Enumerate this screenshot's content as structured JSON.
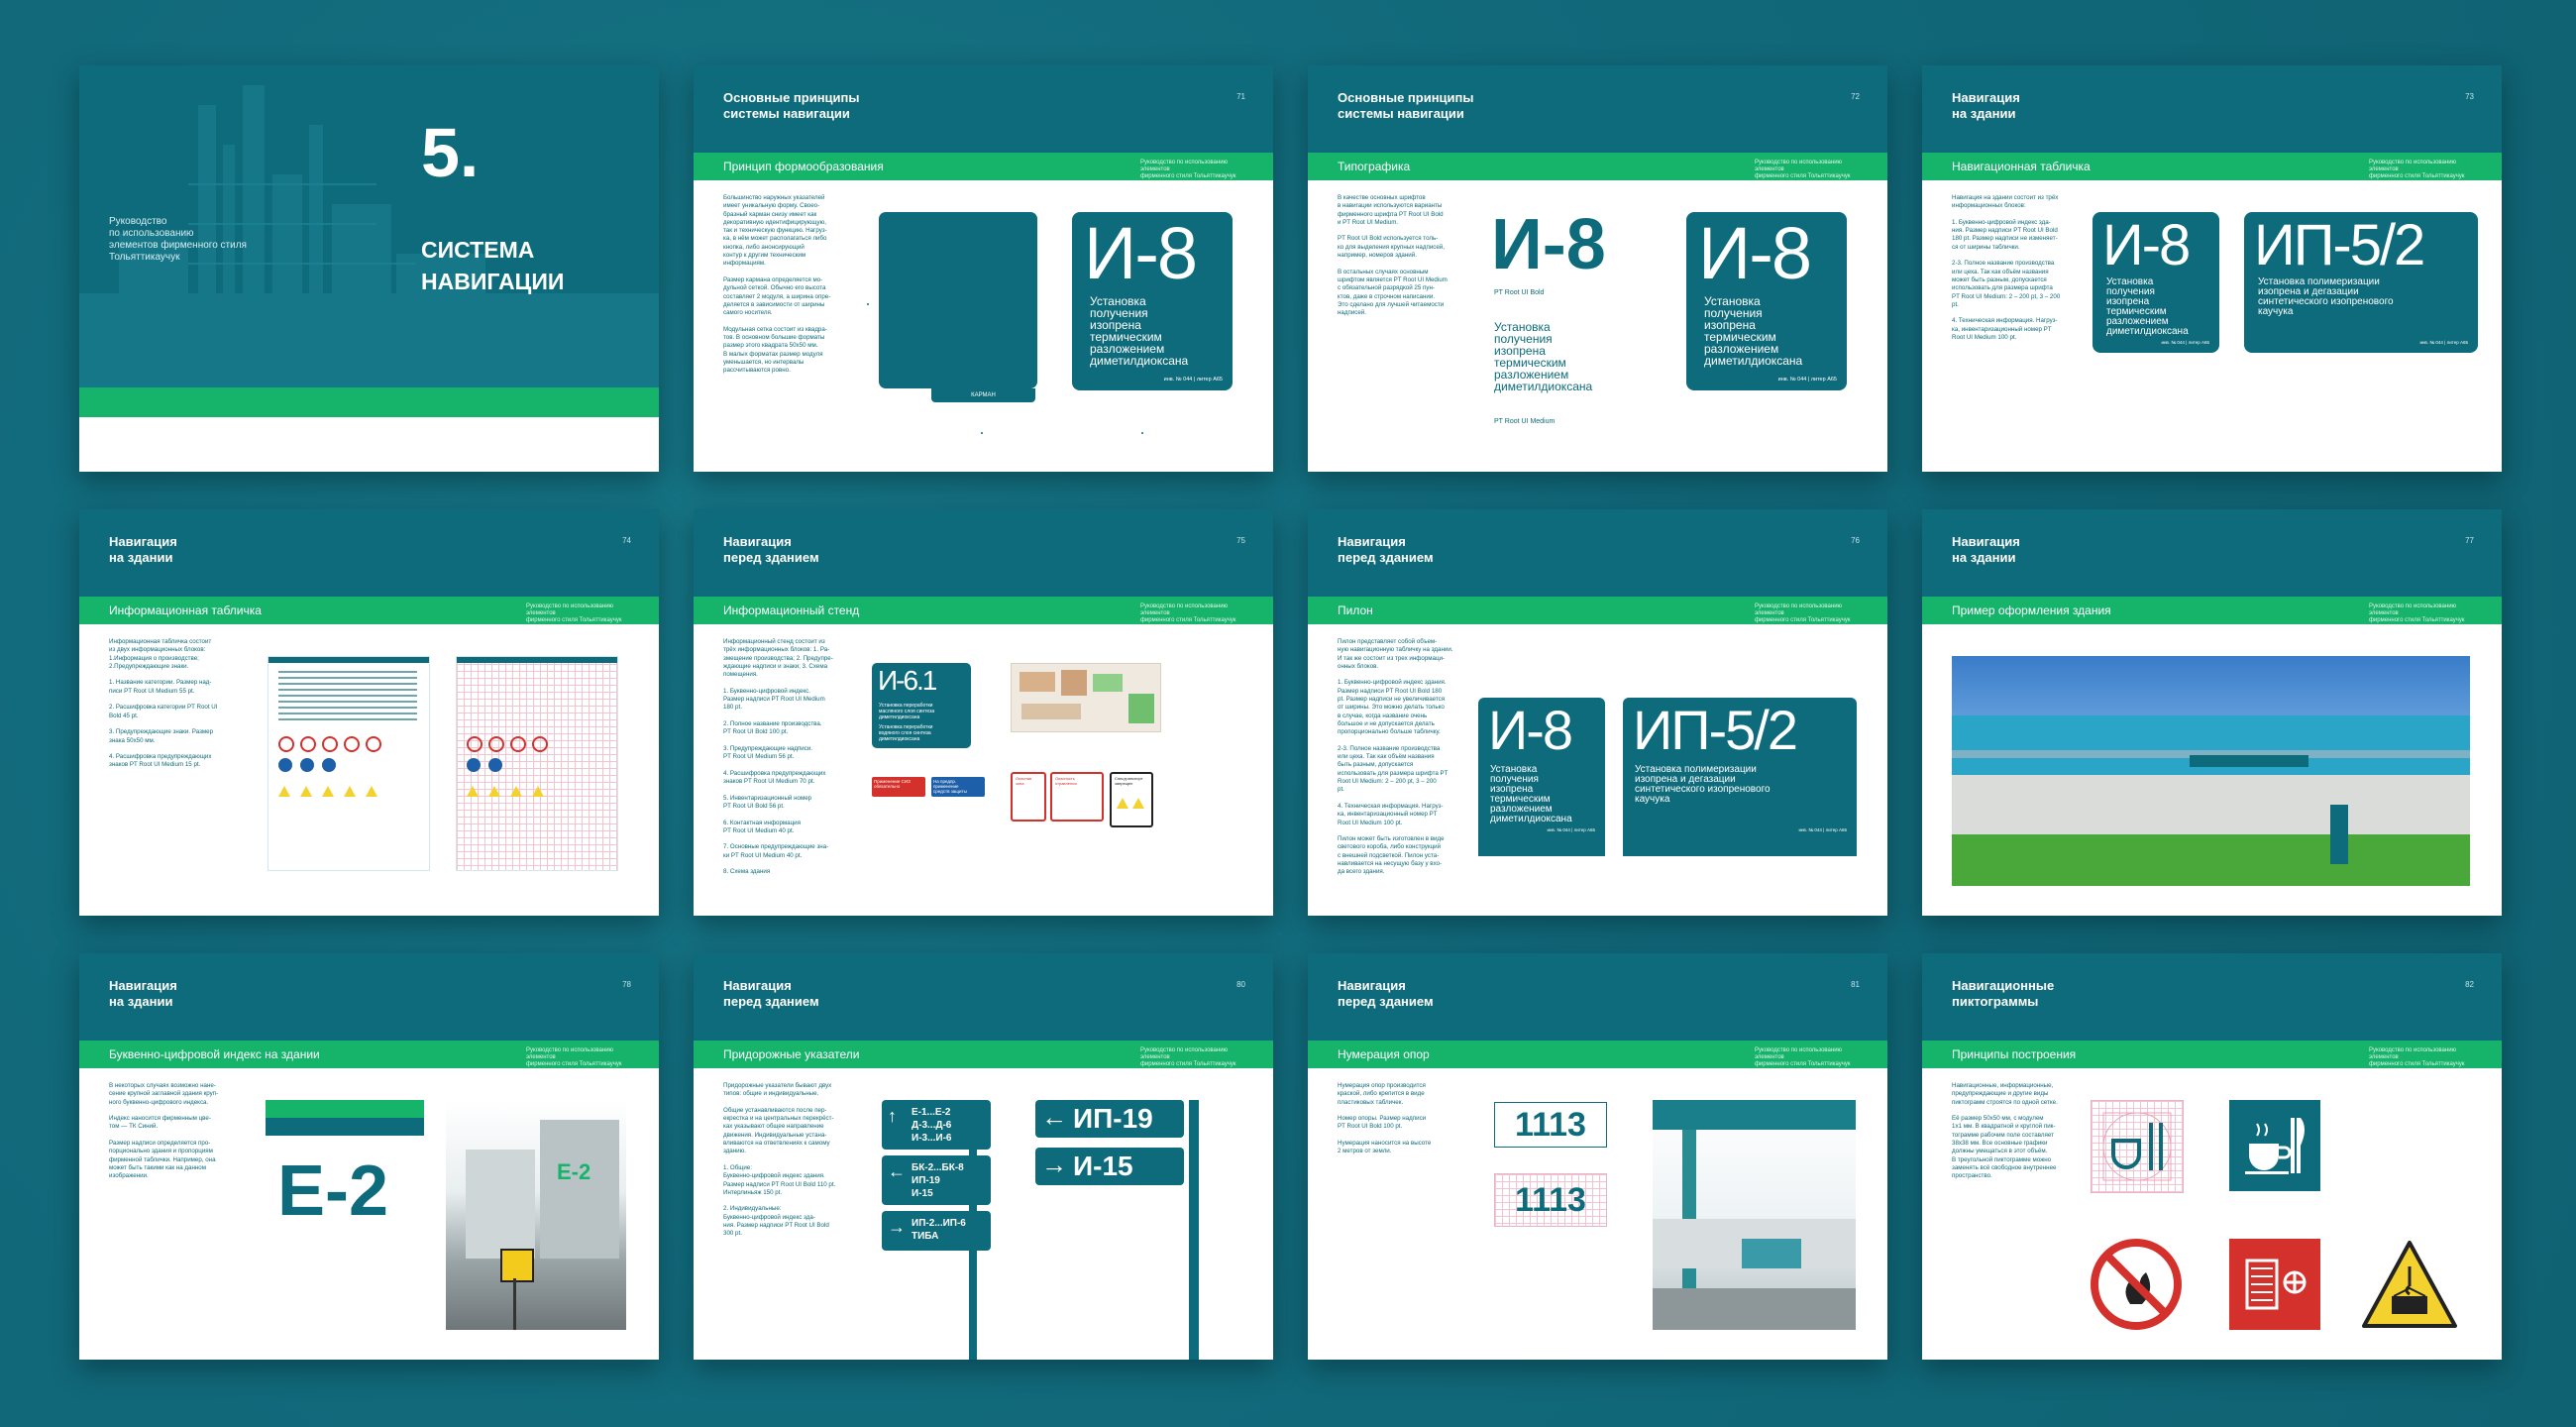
{
  "cover": {
    "number": "5.",
    "title": "СИСТЕМА\nНАВИГАЦИИ",
    "subtitle": "Руководство\nпо использованию\nэлементов фирменного стиля\nТольяттикаучук"
  },
  "common": {
    "caption": "Руководство по использованию элементов\nфирменного стиля Тольяттикаучук",
    "desc_i8": "Установка\nполучения\nизопрена\nтермическим\nразложением\nдиметилдиоксана",
    "desc_ip52": "Установка полимеризации\nизопрена и дегазации\nсинтетического изопренового\nкаучука",
    "index_i8": "И-8",
    "index_ip52": "ИП-5/2",
    "foot_i8": "инв. № 044 | литер А65",
    "foot_ip52": "инв. № 044 | литер А65"
  },
  "slides": [
    {
      "title": "Основные принципы\nсистемы навигации",
      "number": "71",
      "subtitle": "Принцип формообразования",
      "text": "Большинство наружных указателей\nимеет уникальную форму. Своео-\nбразный карман снизу имеет как\nдекоративную идентифицирующую,\nтак и техническую функцию. Нагруз-\nка, в нём может располагаться либо\nкнопка, либо анонсирующий\nконтур к другим техническим\nинформациям.\n\nРазмер кармана определяется мо-\nдульной сеткой. Обычно его высота\nсоставляет 2 модуля, а ширина опре-\nделяется в зависимости от ширины\nсамого носителя.\n\nМодульная сетка состоит из квадра-\nтов. В основном большие форматы\nразмер этого квадрата 50х50 мм.\nВ малых форматах размер модуля\nуменьшается, но интервалы\nрассчитываются ровно.",
      "pocket": "КАРМАН"
    },
    {
      "title": "Основные принципы\nсистемы навигации",
      "number": "72",
      "subtitle": "Типографика",
      "text": "В качестве основных шрифтов\nв навигации используются варианты\nфирменного шрифта PT Root UI Bold\nи PT Root UI Medium.\n\nPT Root UI Bold используется толь-\nко для выделения крупных надписей,\nнапример, номеров зданий.\n\nВ остальных случаях основным\nшрифтом является PT Root UI Medium\nс обязательной разрядкой 25 пун-\nктов, даже в строчном написании.\nЭто сделано для лучшей читаемости\nнадписей.",
      "font_bold": "PT Root UI Bold",
      "font_medium": "PT Root UI Medium"
    },
    {
      "title": "Навигация\nна здании",
      "number": "73",
      "subtitle": "Навигационная табличка",
      "text": "Навигация на здании состоит из трёх\nинформационных блоков:\n\n1. Буквенно-цифровой индекс зда-\nния. Размер надписи PT Root UI Bold\n180 pt. Размер надписи не изменяет-\nся от ширины таблички.\n\n2-3. Полное название производства\nили цеха. Так как объём названия\nможет быть разным, допускается\nиспользовать для размера шрифта\nPT Root UI Medium: 2 – 200 pt, 3 – 200\npt.\n\n4. Техническая информация. Нагруз-\nка, инвентаризационный номер PT\nRoot UI Medium 100 pt."
    },
    {
      "title": "Навигация\nна здании",
      "number": "74",
      "subtitle": "Информационная табличка",
      "text": "Информационная табличка состоит\nиз двух информационных блоков:\n1.Информация о производстве;\n2.Предупреждающие знаки.\n\n1. Название категории. Размер над-\nписи PT Root UI Medium 55 pt.\n\n2. Расшифровка категории PT Root UI\nBold 45 pt.\n\n3. Предупреждающие знаки. Размер\nзнака 50х50 мм.\n\n4. Расшифровка предупреждающих\nзнаков PT Root UI Medium 15 pt."
    },
    {
      "title": "Навигация\nперед зданием",
      "number": "75",
      "subtitle": "Информационный стенд",
      "text": "Информационный стенд состоит из\nтрёх информационных блоков: 1. Ра-\nзмещение производства; 2. Предупре-\nждающие надписи и знаки; 3. Схема\nпомещения.\n\n1. Буквенно-цифровой индекс.\nРазмер надписи PT Root UI Medium\n180 pt.\n\n2. Полное название производства.\nPT Root UI Bold 100 pt.\n\n3. Предупреждающие надписи.\nPT Root UI Medium 56 pt.\n\n4. Расшифровка предупреждающих\nзнаков PT Root UI Medium 70 pt.\n\n5. Инвентаризационный номер\nPT Root UI Bold 56 pt.\n\n6. Контактная информация\nPT Root UI Medium 40 pt.\n\n7. Основные предупреждающие зна-\nки PT Root UI Medium 40 pt.\n\n8. Схема здания",
      "index": "И-6.1",
      "desc": "Установка переработки\nмасляного слоя синтеза\nдиметилдиоксана",
      "desc2": "Установка переработки\nводяного слоя синтеза\nдиметилдиоксана",
      "label_a": "Применение СИЗ\nобязательно",
      "label_b": "На предпр.\nприменение\nсредств защиты",
      "label_c": "Опасная\nзона",
      "label_d": "Опасность\nотравления",
      "label_e": "Спецтранспорт\nзапрещен"
    },
    {
      "title": "Навигация\nперед зданием",
      "number": "76",
      "subtitle": "Пилон",
      "text": "Пилон представляет собой объем-\nную навигационную табличку на здании.\nИ так же состоит из трех информаци-\nонных блоков.\n\n1. Буквенно-цифровой индекс здания.\nРазмер надписи PT Root UI Bold 180\npt. Размер надписи не увеличивается\nот ширины. Это можно делать только\nв случае, когда название очень\nбольшое и не допускается делать\nпропорционально больше табличку.\n\n2-3. Полное название производства\nили цеха. Так как объём названия\nбыть разным, допускается\nиспользовать для размера шрифта PT\nRoot UI Medium: 2 – 200 pt, 3 – 200\npt.\n\n4. Техническая информация. Нагруз-\nка, инвентаризационный номер PT\nRoot UI Medium 100 pt.\n\nПилон может быть изготовлен в виде\nсветового короба, либо конструкций\nс внешней подсветкой. Пилон уста-\nнавливается на несущую базу у вхо-\nда всего здания."
    },
    {
      "title": "Навигация\nна здании",
      "number": "77",
      "subtitle": "Пример оформления здания"
    },
    {
      "title": "Навигация\nна здании",
      "number": "78",
      "subtitle": "Буквенно-цифровой индекс на здании",
      "text": "В некоторых случаях возможно нане-\nсение крупной заглавной здания круп-\nного буквенно-цифрового индекса.\n\nИндекс наносится фирменным цве-\nтом — ТК Синий.\n\nРазмер надписи определяется про-\nпорционально здания и пропорциям\nфирменной таблички. Например, она\nможет быть такими как на данном\nизображении.",
      "index": "Е-2"
    },
    {
      "title": "Навигация\nперед зданием",
      "number": "80",
      "subtitle": "Придорожные указатели",
      "text": "Придорожные указатели бывают двух\nтипов: общие и индивидуальные.\n\nОбщие устанавливаются после пер-\nекрестка и на центральных перекрёст-\nках указывают общее направление\nдвижения. Индивидуальные устана-\nвливаются на ответвлениях к самому\nзданию.\n\n1. Общие:\nБуквенно-цифровой индекс здания.\nРазмер надписи PT Root UI Bold 110 pt.\nИнтерлиньяж 150 pt.\n\n2. Индивидуальные:\nБуквенно-цифровой индекс зда-\nния. Размер надписи PT Root UI Bold\n300 pt.",
      "r1": "Е-1...Е-2\nД-3...Д-6\nИ-3...И-6",
      "r2": "БК-2...БК-8\nИП-19\nИ-15",
      "r3": "ИП-2...ИП-6\nТИБА",
      "r4": "ИП-19",
      "r5": "И-15"
    },
    {
      "title": "Навигация\nперед зданием",
      "number": "81",
      "subtitle": "Нумерация опор",
      "text": "Нумерация опор производится\nкраской, либо крепится в виде\nпластиковых табличек.\n\nНомер опоры. Размер надписи\nPT Root UI Bold 100 pt.\n\nНумерация наносится на высоте\n2 метров от земли.",
      "pole": "1113"
    },
    {
      "title": "Навигационные\nпиктограммы",
      "number": "82",
      "subtitle": "Принципы построения",
      "text": "Навигационные, информационные,\nпредупреждающие и другие виды\nпиктограмм строятся по одной сетке.\n\nЕё размер 50х50 мм, с модулем\n1х1 мм. В квадратной и круглой пик-\nтограмме рабочим поле составляет\n38х38 мм. Все основные графики\nдолжны умещаться в этот объём.\nВ треугольной пиктограмме можно\nзаменять всё свободное внутреннее\nпространство."
    }
  ],
  "colors": {
    "teal": "#0e6b7b",
    "green": "#16b36b",
    "bg": "#126a7a"
  }
}
